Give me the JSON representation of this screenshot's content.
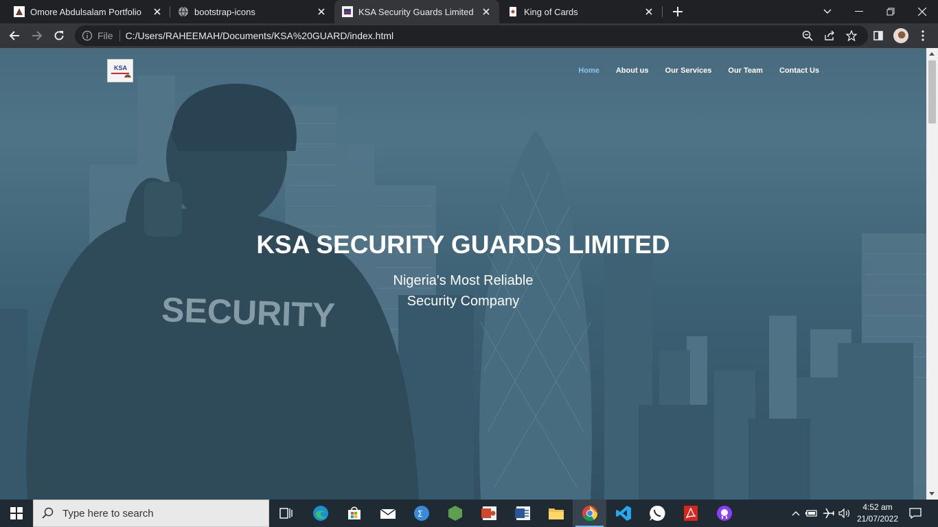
{
  "browser": {
    "tabs": [
      {
        "title": "Omore Abdulsalam Portfolio",
        "active": false
      },
      {
        "title": "bootstrap-icons",
        "active": false
      },
      {
        "title": "KSA Security Guards Limited",
        "active": true
      },
      {
        "title": "King of Cards",
        "active": false
      }
    ],
    "address": {
      "scheme_label": "File",
      "url": "C:/Users/RAHEEMAH/Documents/KSA%20GUARD/index.html"
    }
  },
  "page": {
    "nav": [
      "Home",
      "About us",
      "Our Services",
      "Our Team",
      "Contact Us"
    ],
    "active_nav": "Home",
    "hero_title": "KSA SECURITY GUARDS LIMITED",
    "hero_sub_line1": "Nigeria's Most Reliable",
    "hero_sub_line2": "Security Company",
    "jacket_text": "SECURITY",
    "logo_text": "KSA",
    "colors": {
      "nav_active": "#8ec6e8",
      "overlay": "#3d6174"
    }
  },
  "taskbar": {
    "search_placeholder": "Type here to search",
    "time": "4:52 am",
    "date": "21/07/2022",
    "apps": [
      "task-view",
      "edge",
      "store",
      "mail",
      "math-input",
      "nodejs",
      "ppt",
      "word",
      "file-explorer",
      "chrome",
      "vscode",
      "whatsapp",
      "acrobat",
      "github-desktop"
    ]
  }
}
